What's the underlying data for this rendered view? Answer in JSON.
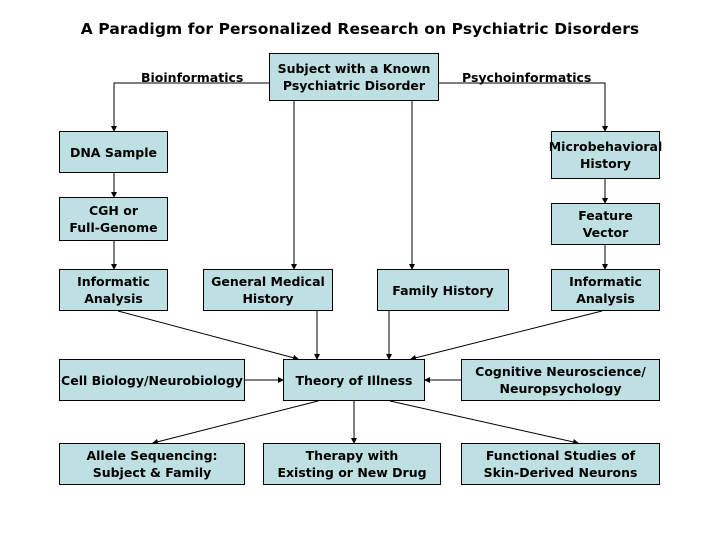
{
  "title": "A Paradigm for Personalized Research on Psychiatric Disorders",
  "colors": {
    "box_fill": "#bfe0e2",
    "line": "#000000"
  },
  "labels": {
    "left_branch": "Bioinformatics",
    "right_branch": "Psychoinformatics"
  },
  "nodes": {
    "subject": "Subject with a Known\nPsychiatric Disorder",
    "dna": "DNA Sample",
    "cgh": "CGH or\nFull-Genome",
    "informatic_left": "Informatic\nAnalysis",
    "general_medical": "General Medical\nHistory",
    "family_history": "Family History",
    "micro": "Microbehavioral\nHistory",
    "feature": "Feature\nVector",
    "informatic_right": "Informatic\nAnalysis",
    "cell_bio": "Cell Biology/Neurobiology",
    "theory": "Theory of Illness",
    "cognitive": "Cognitive Neuroscience/\nNeuropsychology",
    "allele": "Allele Sequencing:\nSubject & Family",
    "therapy": "Therapy with\nExisting or New Drug",
    "functional": "Functional Studies of\nSkin-Derived Neurons"
  },
  "edges": [
    [
      "subject",
      "dna"
    ],
    [
      "dna",
      "cgh"
    ],
    [
      "cgh",
      "informatic_left"
    ],
    [
      "subject",
      "general_medical"
    ],
    [
      "subject",
      "family_history"
    ],
    [
      "subject",
      "micro"
    ],
    [
      "micro",
      "feature"
    ],
    [
      "feature",
      "informatic_right"
    ],
    [
      "informatic_left",
      "theory"
    ],
    [
      "general_medical",
      "theory"
    ],
    [
      "family_history",
      "theory"
    ],
    [
      "informatic_right",
      "theory"
    ],
    [
      "cell_bio",
      "theory"
    ],
    [
      "cognitive",
      "theory"
    ],
    [
      "theory",
      "allele"
    ],
    [
      "theory",
      "therapy"
    ],
    [
      "theory",
      "functional"
    ]
  ]
}
